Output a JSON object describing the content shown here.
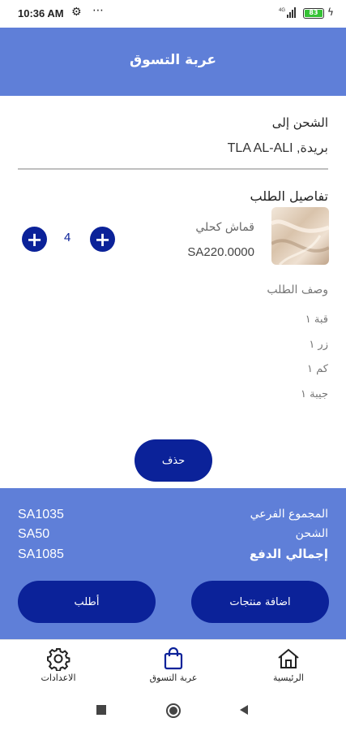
{
  "status_bar": {
    "time": "10:36 AM",
    "dots": "⋯",
    "battery": "83",
    "network": "4G"
  },
  "header": {
    "title": "عربة التسوق"
  },
  "shipping": {
    "title": "الشحن إلى",
    "address": "TLA AL-ALI ,بريدة"
  },
  "order_details": {
    "title": "تفاصيل الطلب",
    "product": {
      "name": "قماش كحلي",
      "price": "SA220.0000",
      "quantity": "4"
    },
    "description_title": "وصف الطلب",
    "description_items": [
      "قبة ١",
      "زر ١",
      "كم ١",
      "جيبة ١"
    ],
    "delete_label": "حذف"
  },
  "summary": {
    "subtotal_label": "المجموع الفرعي",
    "subtotal_value": "SA1035",
    "shipping_label": "الشحن",
    "shipping_value": "SA50",
    "total_label": "إجمالي الدفع",
    "total_value": "SA1085",
    "order_button": "أطلب",
    "add_products_button": "اضافة منتجات"
  },
  "bottom_nav": {
    "settings": "الاعدادات",
    "cart": "عربة التسوق",
    "home": "الرئيسية"
  },
  "colors": {
    "primary": "#5f7fd8",
    "accent": "#0b2299"
  }
}
